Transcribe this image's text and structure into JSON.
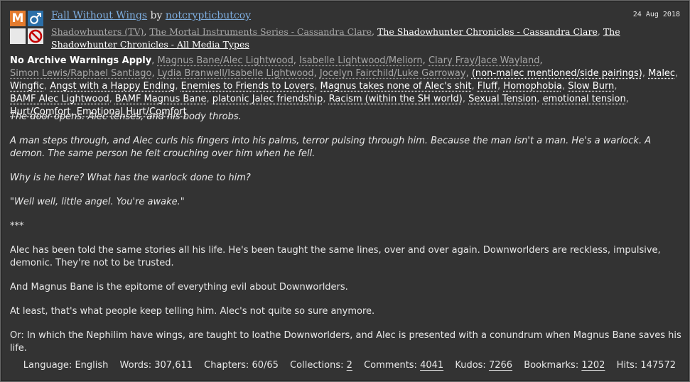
{
  "work": {
    "title": "Fall Without Wings",
    "by": "by",
    "author": "notcrypticbutcoy",
    "date": "24 Aug 2018",
    "symbols": {
      "rating": "M",
      "category_icon": "male-symbol-icon",
      "warning_icon": "no-warning-icon",
      "completion_icon": "prohibited-icon",
      "colors": {
        "rating": "#e47b2d",
        "category": "#2b6fa8",
        "prohibited": "#c40000"
      }
    },
    "fandoms": [
      "Shadowhunters (TV)",
      "The Mortal Instruments Series - Cassandra Clare",
      "The Shadowhunter Chronicles - Cassandra Clare",
      "The Shadowhunter Chronicles - All Media Types"
    ],
    "warning": "No Archive Warnings Apply",
    "relationships": [
      "Magnus Bane/Alec Lightwood",
      "Isabelle Lightwood/Meliorn",
      "Clary Fray/Jace Wayland",
      "Simon Lewis/Raphael Santiago",
      "Lydia Branwell/Isabelle Lightwood",
      "Jocelyn Fairchild/Luke Garroway"
    ],
    "freeforms": [
      "(non-malec mentioned/side pairings)",
      "Malec",
      "Wingfic",
      "Angst with a Happy Ending",
      "Enemies to Friends to Lovers",
      "Magnus takes none of Alec's shit",
      "Fluff",
      "Homophobia",
      "Slow Burn",
      "BAMF Alec Lightwood",
      "BAMF Magnus Bane",
      "platonic Jalec friendship",
      "Racism (within the SH world)",
      "Sexual Tension",
      "emotional tension",
      "Hurt/Comfort",
      "Emotional Hurt/Comfort"
    ],
    "summary": [
      {
        "text": "The door opens. Alec tenses, and his body throbs.",
        "italic": true
      },
      {
        "text": "A man steps through, and Alec curls his fingers into his palms, terror pulsing through him. Because the man isn't a man. He's a warlock. A demon. The same person he felt crouching over him when he fell.",
        "italic": true
      },
      {
        "text": "Why is he here? What has the warlock done to him?",
        "italic": true
      },
      {
        "text": "\"Well well, little angel. You're awake.\"",
        "italic": true
      },
      {
        "text": "***",
        "italic": false
      },
      {
        "text": "Alec has been told the same stories all his life. He's been taught the same lines, over and over again. Downworlders are reckless, impulsive, demonic. They're not to be trusted.",
        "italic": false
      },
      {
        "text": "And Magnus Bane is the epitome of everything evil about Downworlders.",
        "italic": false
      },
      {
        "text": "At least, that's what people keep telling him. Alec's not quite so sure anymore.",
        "italic": false
      },
      {
        "text": "Or: In which the Nephilim have wings, are taught to loathe Downworlders, and Alec is presented with a conundrum when Magnus Bane saves his life.",
        "italic": false
      }
    ],
    "stats": [
      {
        "label": "Language:",
        "value": "English",
        "link": false
      },
      {
        "label": "Words:",
        "value": "307,611",
        "link": false
      },
      {
        "label": "Chapters:",
        "value": "60/65",
        "link": false
      },
      {
        "label": "Collections:",
        "value": "2",
        "link": true
      },
      {
        "label": "Comments:",
        "value": "4041",
        "link": true
      },
      {
        "label": "Kudos:",
        "value": "7266",
        "link": true
      },
      {
        "label": "Bookmarks:",
        "value": "1202",
        "link": true
      },
      {
        "label": "Hits:",
        "value": "147572",
        "link": false
      }
    ]
  }
}
